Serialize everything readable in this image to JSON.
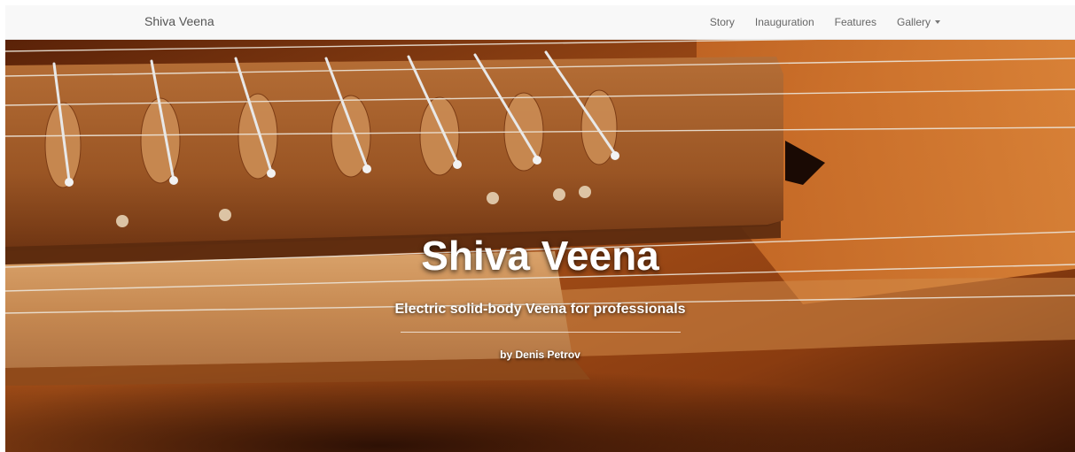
{
  "navbar": {
    "brand": "Shiva Veena",
    "items": [
      {
        "label": "Story"
      },
      {
        "label": "Inauguration"
      },
      {
        "label": "Features"
      },
      {
        "label": "Gallery",
        "has_dropdown": true
      }
    ]
  },
  "hero": {
    "title": "Shiva Veena",
    "subtitle": "Electric solid-body Veena for professionals",
    "byline": "by Denis Petrov"
  },
  "colors": {
    "navbar_bg": "#f8f8f8",
    "nav_text": "#666666",
    "hero_text": "#ffffff",
    "wood_dark": "#4a1c08",
    "wood_mid": "#a4531c",
    "wood_light": "#c98c52"
  }
}
